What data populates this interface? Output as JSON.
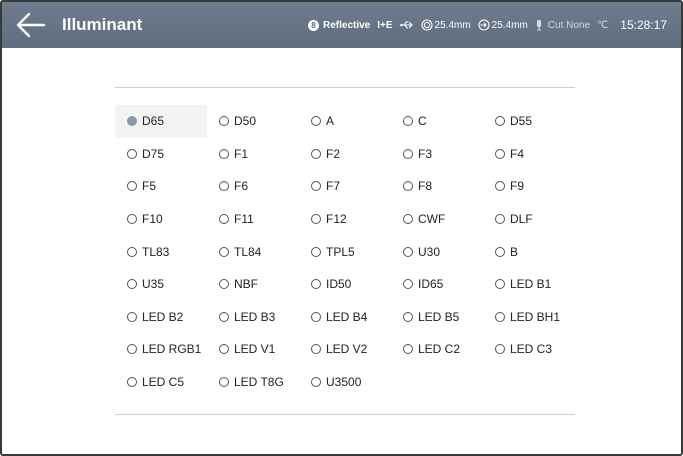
{
  "header": {
    "title": "Illuminant",
    "mode": "Reflective",
    "ie": "I+E",
    "aperture1": "25.4mm",
    "aperture2": "25.4mm",
    "cut": "Cut None",
    "temp_unit": "℃",
    "time": "15:28:17",
    "badge": "8"
  },
  "colors": {
    "header_bg": "#6a7789",
    "selected_radio": "#8c97a8"
  },
  "illuminant": {
    "selected": "D65",
    "options": [
      "D65",
      "D50",
      "A",
      "C",
      "D55",
      "D75",
      "F1",
      "F2",
      "F3",
      "F4",
      "F5",
      "F6",
      "F7",
      "F8",
      "F9",
      "F10",
      "F11",
      "F12",
      "CWF",
      "DLF",
      "TL83",
      "TL84",
      "TPL5",
      "U30",
      "B",
      "U35",
      "NBF",
      "ID50",
      "ID65",
      "LED B1",
      "LED B2",
      "LED B3",
      "LED B4",
      "LED B5",
      "LED BH1",
      "LED RGB1",
      "LED V1",
      "LED V2",
      "LED C2",
      "LED C3",
      "LED C5",
      "LED T8G",
      "U3500"
    ]
  }
}
